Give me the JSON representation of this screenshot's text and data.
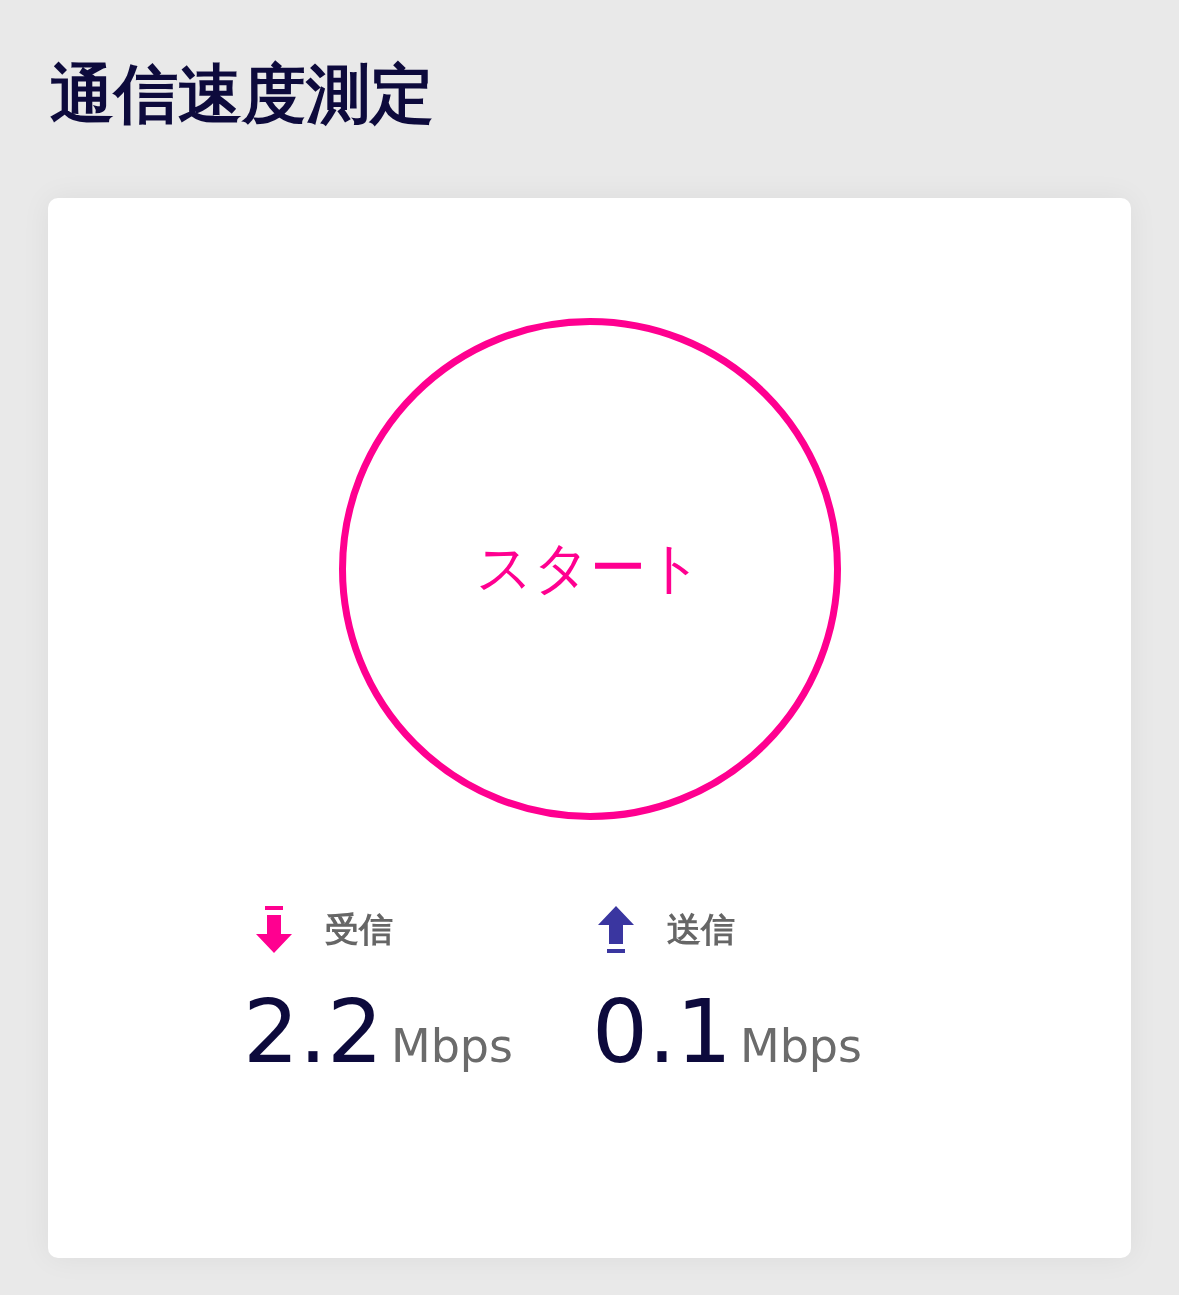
{
  "title": "通信速度測定",
  "start_button": {
    "label": "スタート"
  },
  "stats": [
    {
      "kind": "download",
      "label": "受信",
      "color": "#ff0090",
      "value": "2.2",
      "unit": "Mbps"
    },
    {
      "kind": "upload",
      "label": "送信",
      "color": "#3a36a0",
      "value": "0.1",
      "unit": "Mbps"
    }
  ]
}
